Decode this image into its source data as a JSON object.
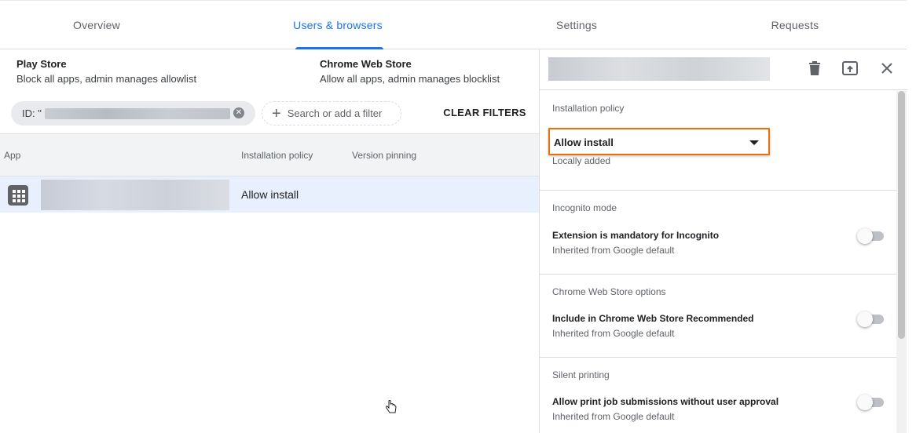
{
  "tabs": [
    {
      "label": "Overview"
    },
    {
      "label": "Users & browsers",
      "active": true
    },
    {
      "label": "Settings"
    },
    {
      "label": "Requests"
    }
  ],
  "summary": {
    "play_store": {
      "title": "Play Store",
      "desc": "Block all apps, admin manages allowlist"
    },
    "chrome_web_store": {
      "title": "Chrome Web Store",
      "desc": "Allow all apps, admin manages blocklist"
    }
  },
  "filters": {
    "chip_label": "ID: \"",
    "add_filter_placeholder": "Search or add a filter",
    "clear_label": "CLEAR FILTERS"
  },
  "table": {
    "headers": [
      "App",
      "Installation policy",
      "Version pinning"
    ],
    "rows": [
      {
        "installation_policy": "Allow install"
      }
    ]
  },
  "panel": {
    "icons": [
      "delete-icon",
      "open-in-new-icon",
      "close-icon"
    ],
    "installation_policy": {
      "title": "Installation policy",
      "selected": "Allow install",
      "sub": "Locally added"
    },
    "sections": [
      {
        "title": "Incognito mode",
        "label": "Extension is mandatory for Incognito",
        "sub": "Inherited from Google default",
        "enabled": false
      },
      {
        "title": "Chrome Web Store options",
        "label": "Include in Chrome Web Store Recommended",
        "sub": "Inherited from Google default",
        "enabled": false
      },
      {
        "title": "Silent printing",
        "label": "Allow print job submissions without user approval",
        "sub": "Inherited from Google default",
        "enabled": false
      }
    ]
  },
  "colors": {
    "accent": "#1a73e8",
    "highlight_border": "#e8710a",
    "selected_row": "#e8f0fe"
  }
}
